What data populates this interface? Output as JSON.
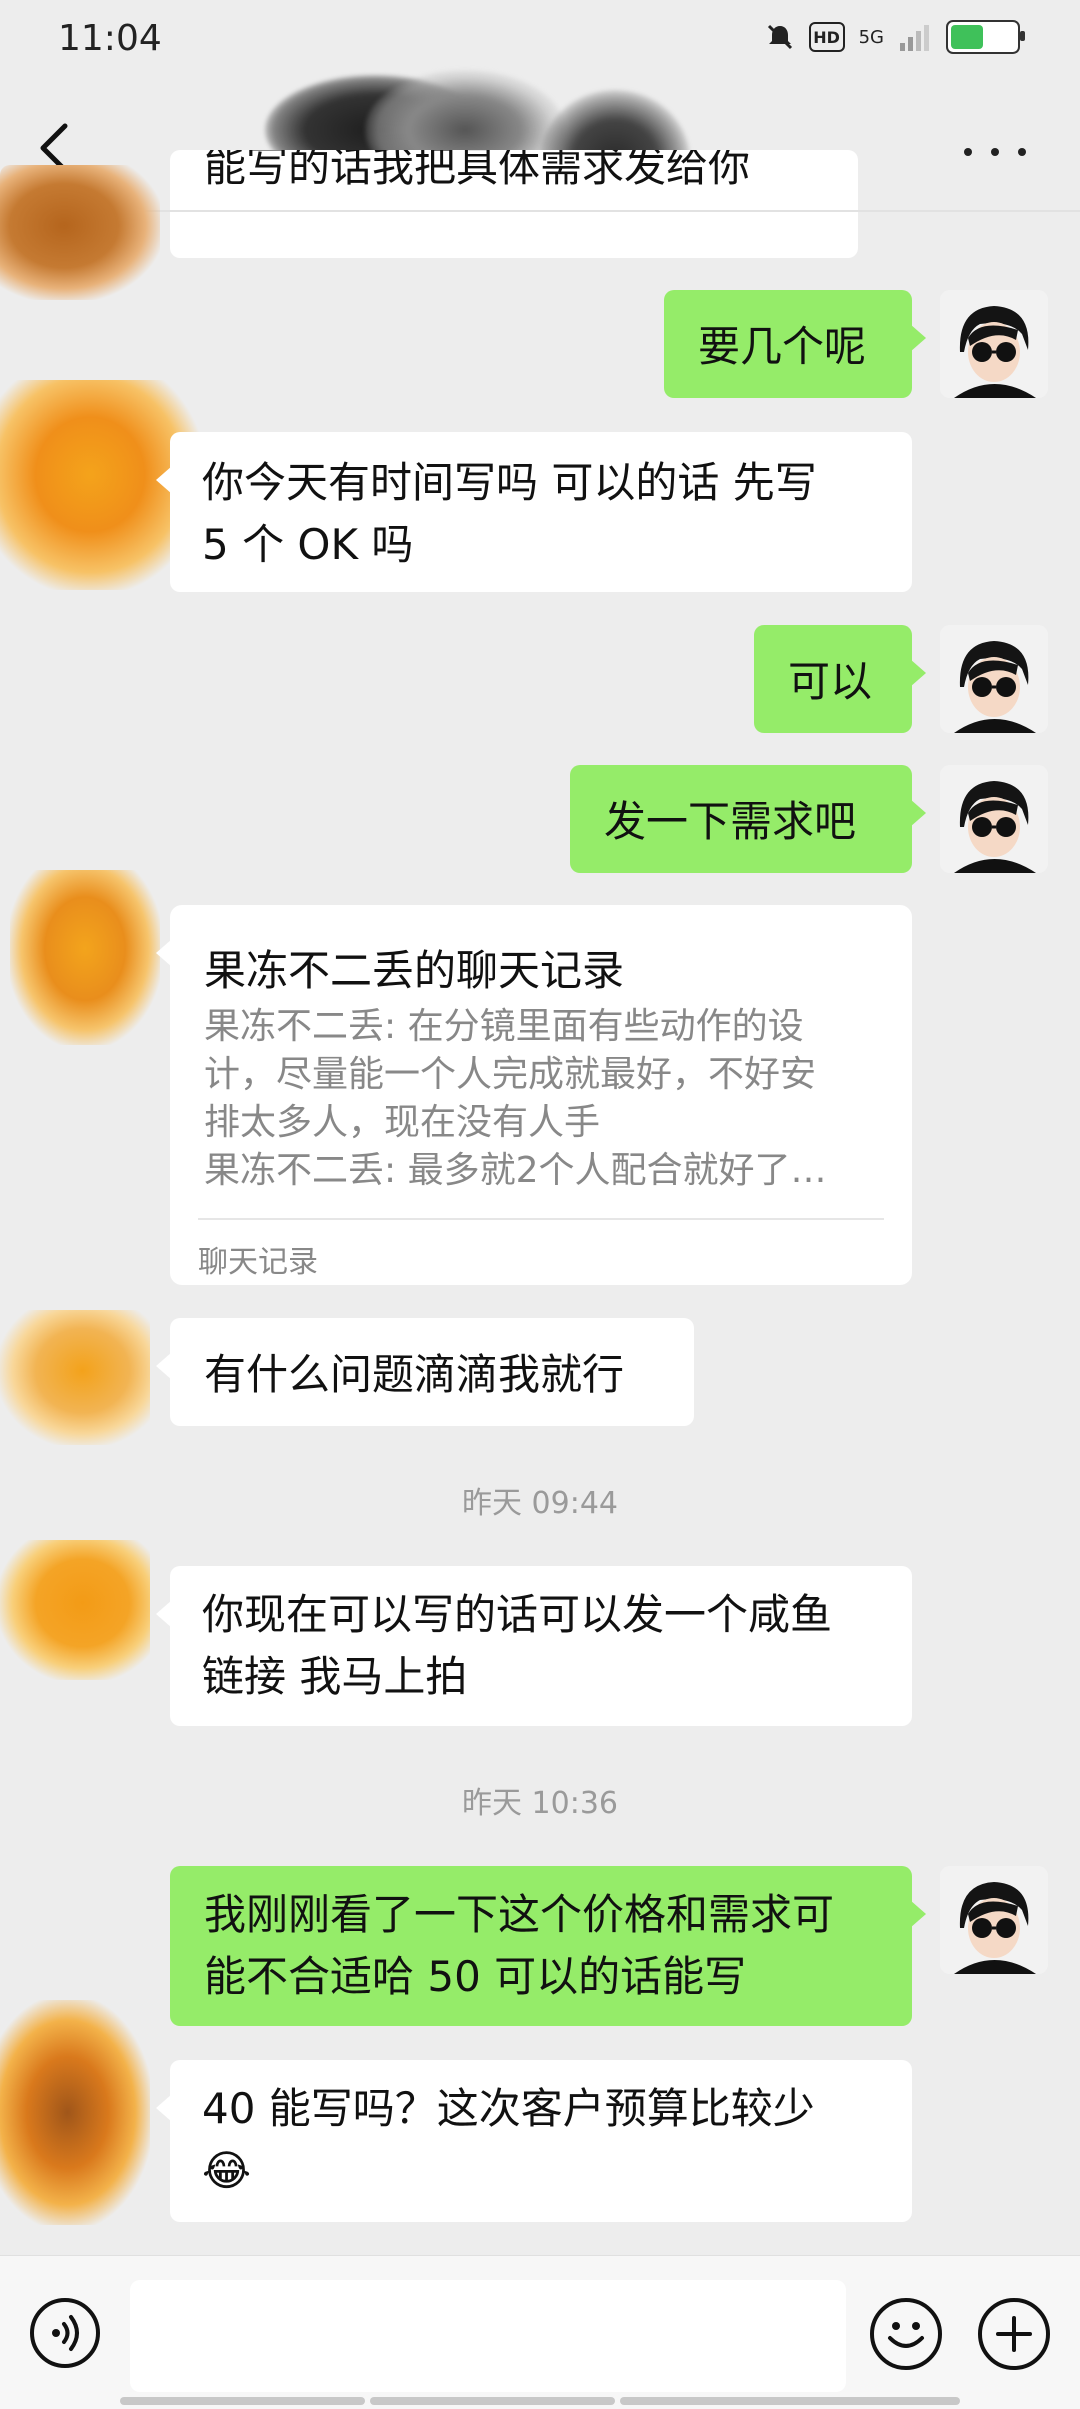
{
  "status_bar": {
    "time": "11:04",
    "network": "5G",
    "icons": [
      "bell-mute-icon",
      "hd-icon",
      "signal-icon",
      "battery-icon"
    ]
  },
  "header": {
    "back_icon": "chevron-left-icon",
    "more_icon": "more-dots-icon"
  },
  "messages": {
    "m0": "能写的话我把具体需求发给你",
    "m1": "要几个呢",
    "m2a": "你今天有时间写吗 可以的话 先写",
    "m2b": "5 个 OK 吗",
    "m3": "可以",
    "m4": "发一下需求吧",
    "m6": "有什么问题滴滴我就行",
    "ts1": "昨天 09:44",
    "m7a": "你现在可以写的话可以发一个咸鱼",
    "m7b": "链接 我马上拍",
    "ts2": "昨天 10:36",
    "m8a": "我刚刚看了一下这个价格和需求可",
    "m8b": "能不合适哈 50 可以的话能写",
    "m9a": "40 能写吗？这次客户预算比较少",
    "m9b": "😂"
  },
  "chat_record": {
    "title": "果冻不二丢的聊天记录",
    "line1": "果冻不二丢: 在分镜里面有些动作的设",
    "line2": "计，尽量能一个人完成就最好，不好安",
    "line3": "排太多人，现在没有人手",
    "line4": "果冻不二丢: 最多就2个人配合就好了…",
    "footer": "聊天记录"
  },
  "input_bar": {
    "voice_icon": "voice-icon",
    "emoji_icon": "emoji-icon",
    "plus_icon": "plus-icon"
  },
  "colors": {
    "background": "#ededed",
    "sent_bubble": "#95ec69",
    "received_bubble": "#ffffff",
    "timestamp": "#9a9a9a"
  }
}
